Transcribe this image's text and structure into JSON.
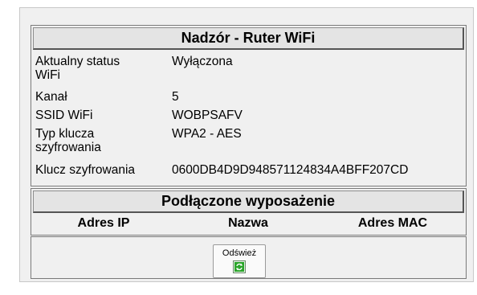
{
  "wifi_panel": {
    "title": "Nadzór - Ruter WiFi",
    "rows": [
      {
        "label": "Aktualny status WiFi",
        "value": "Wyłączona"
      },
      {
        "label": "Kanał",
        "value": "5"
      },
      {
        "label": "SSID WiFi",
        "value": "WOBPSAFV"
      },
      {
        "label": "Typ klucza szyfrowania",
        "value": "WPA2 - AES"
      },
      {
        "label": "Klucz szyfrowania",
        "value": "0600DB4D9D948571124834A4BFF207CD"
      }
    ]
  },
  "devices_panel": {
    "title": "Podłączone wyposażenie",
    "columns": [
      "Adres IP",
      "Nazwa",
      "Adres MAC"
    ]
  },
  "refresh": {
    "label": "Odśwież",
    "icon": "refresh-icon",
    "icon_color": "#2aa52a"
  }
}
